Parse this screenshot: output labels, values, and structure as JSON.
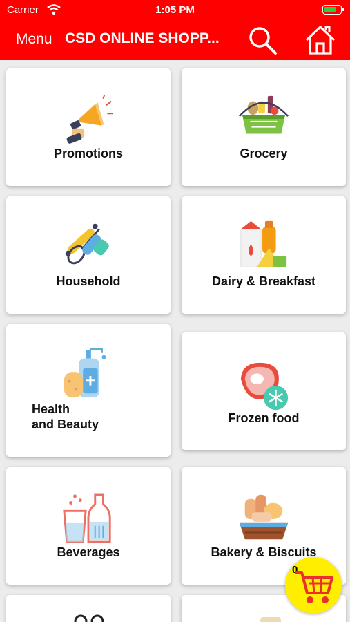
{
  "status_bar": {
    "carrier": "Carrier",
    "time": "1:05 PM"
  },
  "header": {
    "menu_label": "Menu",
    "title": "CSD ONLINE SHOPP..."
  },
  "categories": [
    {
      "label": "Promotions",
      "icon": "megaphone-icon"
    },
    {
      "label": "Grocery",
      "icon": "grocery-basket-icon"
    },
    {
      "label": "Household",
      "icon": "kitchen-utensils-icon"
    },
    {
      "label": "Dairy & Breakfast",
      "icon": "milk-juice-cheese-icon"
    },
    {
      "label": "Health\nand Beauty",
      "icon": "soap-dispenser-sponge-icon"
    },
    {
      "label": "Frozen food",
      "icon": "frozen-meat-snowflake-icon"
    },
    {
      "label": "Beverages",
      "icon": "drinks-bottle-glass-icon"
    },
    {
      "label": "Bakery & Biscuits",
      "icon": "bread-basket-icon"
    }
  ],
  "cart": {
    "count": "0"
  },
  "colors": {
    "header": "#ff0000",
    "cart_button": "#ffee00",
    "cart_icon": "#e8312a"
  }
}
